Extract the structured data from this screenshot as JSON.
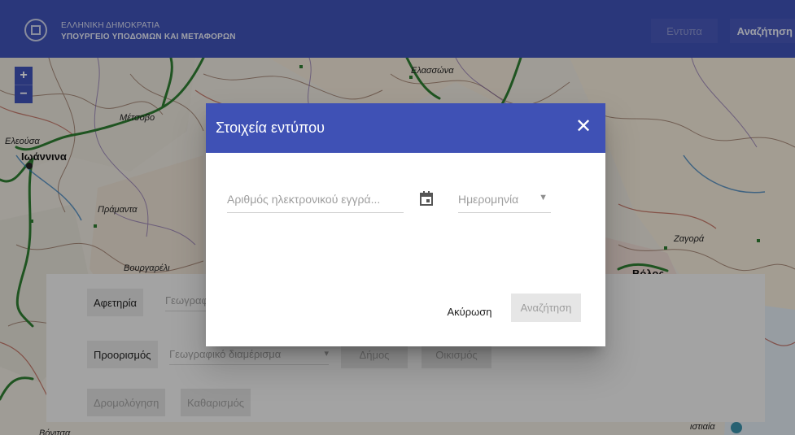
{
  "header": {
    "line1": "ΕΛΛΗΝΙΚΗ ΔΗΜΟΚΡΑΤΙΑ",
    "line2": "ΥΠΟΥΡΓΕΙΟ ΥΠΟΔΟΜΩΝ ΚΑΙ ΜΕΤΑΦΟΡΩΝ",
    "forms_button": "Εντυπα",
    "search_button": "Αναζήτηση"
  },
  "map": {
    "zoom_in": "+",
    "zoom_out": "−",
    "labels": {
      "elassona": "Ελασσώνα",
      "metsovo": "Μέτσοβο",
      "eleousa": "Ελεούσα",
      "ioannina": "Ιωάννινα",
      "pramanta": "Πράμαντα",
      "zagora": "Ζαγορά",
      "vourgareli": "Βουργαρέλι",
      "volos": "Βόλος",
      "vonitsa": "Βόνιτσα",
      "bottom_right": "ιστιαία"
    }
  },
  "routing": {
    "origin_label": "Αφετηρία",
    "origin_field": "Γεωγραφικό διαμέρισμα",
    "destination_label": "Προορισμός",
    "destination_field": "Γεωγραφικό διαμέρισμα",
    "municipality": "Δήμος",
    "settlement": "Οικισμός",
    "route_button": "Δρομολόγηση",
    "clear_button": "Καθαρισμός"
  },
  "dialog": {
    "title": "Στοιχεία εντύπου",
    "close_icon": "close-icon",
    "number_placeholder": "Αριθμός ηλεκτρονικού εγγρά...",
    "date_placeholder": "Ημερομηνία",
    "cancel": "Ακύρωση",
    "search": "Αναζήτηση"
  },
  "colors": {
    "primary": "#3f51b5",
    "road": "#2e7d32"
  }
}
